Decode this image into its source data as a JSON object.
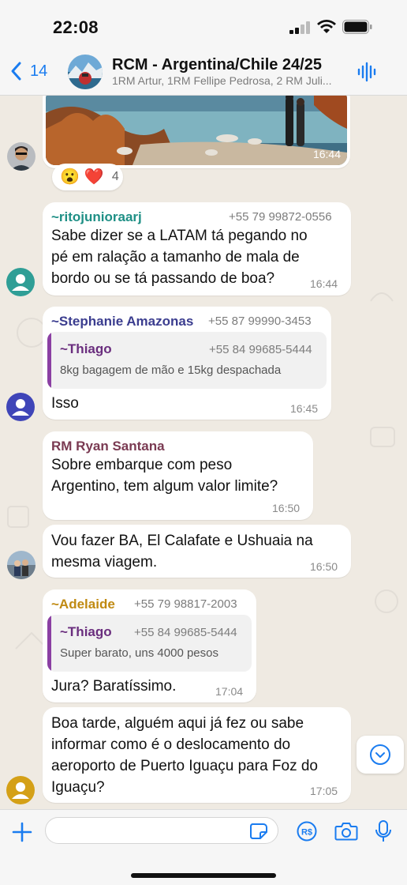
{
  "status_bar": {
    "time": "22:08"
  },
  "header": {
    "back_count": "14",
    "title": "RCM - Argentina/Chile 24/25",
    "subtitle": "1RM Artur, 1RM Fellipe Pedrosa, 2 RM Juli..."
  },
  "photo_message": {
    "time": "16:44"
  },
  "reactions": {
    "emojis": [
      "😮",
      "❤️"
    ],
    "count": "4"
  },
  "messages": [
    {
      "sender": "~ritojunioraarj",
      "phone": "+55 79 99872-0556",
      "sender_color": "#1e8f85",
      "text": "Sabe dizer se a LATAM tá pegando no pé em ralação a tamanho de mala de bordo ou se tá passando de boa?",
      "time": "16:44"
    },
    {
      "sender": "~Stephanie Amazonas",
      "phone": "+55 87 99990-3453",
      "sender_color": "#3b3d8f",
      "quote": {
        "sender": "~Thiago",
        "phone": "+55 84 99685-5444",
        "text": "8kg bagagem de mão e 15kg despachada"
      },
      "text": "Isso",
      "time": "16:45"
    },
    {
      "sender": "RM Ryan Santana",
      "sender_color": "#7a3a52",
      "text": "Sobre embarque com peso Argentino, tem algum valor limite?",
      "time": "16:50"
    },
    {
      "text": "Vou fazer BA, El Calafate e Ushuaia na mesma viagem.",
      "time": "16:50"
    },
    {
      "sender": "~Adelaide",
      "phone": "+55 79 98817-2003",
      "sender_color": "#c08a12",
      "quote": {
        "sender": "~Thiago",
        "phone": "+55 84 99685-5444",
        "text": "Super barato, uns 4000 pesos"
      },
      "text": "Jura? Baratíssimo.",
      "time": "17:04"
    },
    {
      "text": "Boa tarde, alguém aqui já fez ou sabe informar como é o deslocamento do aeroporto de Puerto Iguaçu para Foz do Iguaçu?",
      "time": "17:05"
    }
  ],
  "composer": {
    "placeholder": ""
  },
  "colors": {
    "accent": "#1a7cf0",
    "chat_bg": "#efeae2",
    "quote_bar": "#8b3fa3"
  },
  "icons": [
    "back-chevron-icon",
    "audio-waveform-icon",
    "chevron-down-icon",
    "plus-icon",
    "sticker-icon",
    "pix-payment-icon",
    "camera-icon",
    "microphone-icon"
  ]
}
